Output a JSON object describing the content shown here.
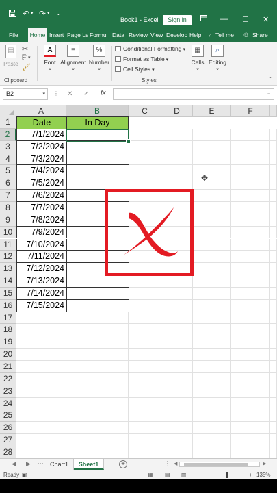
{
  "titlebar": {
    "save_icon": "save-icon",
    "undo_icon": "undo-icon",
    "redo_icon": "redo-icon",
    "title": "Book1 - Excel",
    "signin_label": "Sign in",
    "minimize": "—",
    "restore": "☐",
    "close": "✕",
    "accent_color": "#217346"
  },
  "tabs": [
    {
      "label": "File"
    },
    {
      "label": "Home",
      "active": true
    },
    {
      "label": "Insert"
    },
    {
      "label": "Page La"
    },
    {
      "label": "Formul"
    },
    {
      "label": "Data"
    },
    {
      "label": "Review"
    },
    {
      "label": "View"
    },
    {
      "label": "Develop"
    },
    {
      "label": "Help"
    },
    {
      "label": "Tell me"
    },
    {
      "label": "Share"
    }
  ],
  "ribbon": {
    "clipboard": {
      "paste": "Paste",
      "group": "Clipboard"
    },
    "font": {
      "label": "Font",
      "icon_text": "A"
    },
    "alignment": {
      "label": "Alignment",
      "icon_text": "≡"
    },
    "number": {
      "label": "Number",
      "icon_text": "%"
    },
    "styles": {
      "conditional": "Conditional Formatting",
      "format_table": "Format as Table",
      "cell_styles": "Cell Styles",
      "group": "Styles"
    },
    "cells": {
      "label": "Cells",
      "icon_text": "▦"
    },
    "editing": {
      "label": "Editing",
      "icon_text": "⌕"
    }
  },
  "formula_bar": {
    "name_box": "B2",
    "cancel": "✕",
    "enter": "✓",
    "fx": "fx",
    "value": ""
  },
  "columns": [
    "A",
    "B",
    "C",
    "D",
    "E",
    "F"
  ],
  "rows": [
    "1",
    "2",
    "3",
    "4",
    "5",
    "6",
    "7",
    "8",
    "9",
    "10",
    "11",
    "12",
    "13",
    "14",
    "15",
    "16",
    "17",
    "18",
    "19",
    "20",
    "21",
    "22",
    "23",
    "24",
    "25",
    "26",
    "27",
    "28"
  ],
  "table": {
    "header_a": "Date",
    "header_b": "In Day",
    "header_color": "#92d050",
    "dates": [
      "7/1/2024",
      "7/2/2024",
      "7/3/2024",
      "7/4/2024",
      "7/5/2024",
      "7/6/2024",
      "7/7/2024",
      "7/8/2024",
      "7/9/2024",
      "7/10/2024",
      "7/11/2024",
      "7/12/2024",
      "7/13/2024",
      "7/14/2024",
      "7/15/2024"
    ]
  },
  "selection": {
    "cell": "B2",
    "column": "B",
    "row": "2"
  },
  "overlay": {
    "icon": "red-x-mark-icon",
    "color": "#e31b23"
  },
  "sheets": [
    {
      "label": "Chart1"
    },
    {
      "label": "Sheet1",
      "active": true
    }
  ],
  "status": {
    "ready": "Ready",
    "zoom": "135%",
    "zoom_level": 0.55
  }
}
